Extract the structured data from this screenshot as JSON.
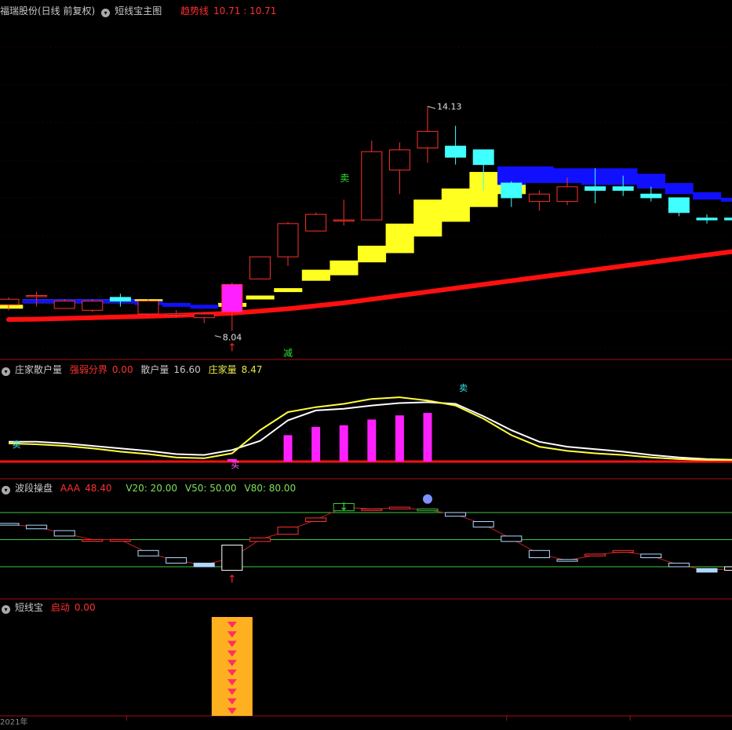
{
  "panels": {
    "main": {
      "stock": "福瑞股份(日线 前复权)",
      "indicator": "短线宝主图",
      "trend_label": "趋势线",
      "trend_value": "10.71 : 10.71",
      "high_label": "14.13",
      "low_label": "8.04",
      "sell_mark": "卖",
      "reduce_mark": "减"
    },
    "zhuangjia": {
      "title": "庄家散户量",
      "f1_label": "强弱分界",
      "f1_value": "0.00",
      "f2_label": "散户量",
      "f2_value": "16.60",
      "f3_label": "庄家量",
      "f3_value": "8.47",
      "sell_left": "卖",
      "sell_right": "卖",
      "buy_mark": "买"
    },
    "boduan": {
      "title": "波段操盘",
      "aaa_label": "AAA",
      "aaa_value": "48.40",
      "v20": "V20: 20.00",
      "v50": "V50: 50.00",
      "v80": "V80: 80.00"
    },
    "duanxianbao": {
      "title": "短线宝",
      "start_label": "启动",
      "start_value": "0.00"
    }
  },
  "footer": {
    "year_label": "2021年"
  },
  "colors": {
    "up": "#ff3030",
    "down": "#40ffff",
    "trend": "#ff1010",
    "yellow_band": "#ffff20",
    "blue_band": "#1010ff",
    "magenta": "#ff20ff",
    "white_line": "#ffffff",
    "yellow_line": "#ffff40",
    "grid_green": "#3cc83c",
    "divider": "#a01010",
    "dotted": "#4a0000"
  },
  "chart_data": [
    {
      "type": "candlestick",
      "ylim": [
        7.4,
        14.6
      ],
      "x": [
        0,
        1,
        2,
        3,
        4,
        5,
        6,
        7,
        8,
        9,
        10,
        11,
        12,
        13,
        14,
        15,
        16,
        17,
        18,
        19,
        20,
        21,
        22,
        23,
        24,
        25,
        26
      ],
      "candles": [
        [
          8.75,
          8.9,
          8.6,
          8.95
        ],
        [
          9.0,
          9.0,
          8.7,
          9.1
        ],
        [
          8.65,
          8.85,
          8.65,
          8.9
        ],
        [
          8.6,
          8.85,
          8.55,
          8.9
        ],
        [
          8.95,
          8.85,
          8.7,
          9.05
        ],
        [
          8.5,
          8.85,
          8.45,
          8.9
        ],
        [
          8.5,
          8.5,
          8.4,
          8.6
        ],
        [
          8.4,
          8.5,
          8.25,
          8.55
        ],
        [
          8.55,
          9.3,
          8.04,
          9.35
        ],
        [
          9.45,
          10.05,
          9.45,
          10.05
        ],
        [
          10.05,
          10.95,
          9.8,
          11.0
        ],
        [
          10.75,
          11.2,
          10.75,
          11.25
        ],
        [
          11.05,
          11.05,
          10.9,
          11.6
        ],
        [
          11.05,
          12.9,
          11.05,
          13.2
        ],
        [
          12.4,
          12.95,
          11.75,
          13.15
        ],
        [
          13.0,
          13.45,
          12.6,
          14.13
        ],
        [
          13.05,
          12.75,
          12.55,
          13.6
        ],
        [
          12.95,
          12.55,
          11.85,
          12.95
        ],
        [
          12.05,
          11.65,
          11.4,
          12.1
        ],
        [
          11.55,
          11.75,
          11.3,
          11.85
        ],
        [
          11.55,
          11.95,
          11.45,
          12.2
        ],
        [
          11.95,
          11.85,
          11.5,
          12.45
        ],
        [
          11.95,
          11.85,
          11.7,
          12.25
        ],
        [
          11.75,
          11.65,
          11.55,
          11.95
        ],
        [
          11.65,
          11.25,
          11.15,
          11.65
        ],
        [
          11.1,
          11.05,
          10.95,
          11.2
        ],
        [
          11.1,
          11.05,
          11.0,
          11.2
        ]
      ],
      "trend_line": [
        8.35,
        8.36,
        8.38,
        8.4,
        8.42,
        8.44,
        8.46,
        8.49,
        8.52,
        8.58,
        8.64,
        8.72,
        8.8,
        8.9,
        9.0,
        9.1,
        9.2,
        9.3,
        9.4,
        9.5,
        9.6,
        9.7,
        9.8,
        9.9,
        10.0,
        10.1,
        10.2
      ],
      "yellow_band": [
        [
          8.75,
          8.75
        ],
        [
          8.8,
          8.9
        ],
        [
          8.8,
          8.9
        ],
        [
          8.8,
          8.9
        ],
        [
          8.8,
          8.9
        ],
        [
          8.85,
          8.9
        ],
        null,
        null,
        [
          8.8,
          8.8
        ],
        [
          9.0,
          9.0
        ],
        [
          9.15,
          9.2
        ],
        [
          9.4,
          9.7
        ],
        [
          9.55,
          9.95
        ],
        [
          9.9,
          10.35
        ],
        [
          10.15,
          10.95
        ],
        [
          10.6,
          11.6
        ],
        [
          11.0,
          11.9
        ],
        [
          11.4,
          12.35
        ],
        [
          11.75,
          12.45
        ],
        null,
        null,
        null,
        null,
        null,
        null,
        null,
        null
      ],
      "blue_band": [
        null,
        [
          8.8,
          8.9
        ],
        [
          8.8,
          8.9
        ],
        [
          8.8,
          8.9
        ],
        [
          8.8,
          8.9
        ],
        [
          8.75,
          8.85
        ],
        [
          8.75,
          8.8
        ],
        [
          8.7,
          8.75
        ],
        null,
        null,
        null,
        null,
        null,
        null,
        null,
        null,
        null,
        null,
        [
          12.0,
          12.5
        ],
        [
          12.05,
          12.5
        ],
        [
          12.05,
          12.45
        ],
        [
          12.0,
          12.45
        ],
        [
          12.0,
          12.45
        ],
        [
          11.9,
          12.3
        ],
        [
          11.75,
          12.05
        ],
        [
          11.6,
          11.8
        ],
        [
          11.55,
          11.65
        ]
      ]
    },
    {
      "type": "line+bar",
      "ylim": [
        0,
        100
      ],
      "series": [
        {
          "name": "散户量",
          "values": [
            24,
            24,
            22,
            19,
            16,
            13,
            9,
            8,
            14,
            25,
            50,
            62,
            64,
            68,
            71,
            72,
            70,
            55,
            38,
            24,
            18,
            15,
            12,
            8,
            5,
            3,
            2
          ]
        },
        {
          "name": "庄家量",
          "values": [
            22,
            21,
            19,
            16,
            12,
            9,
            5,
            4,
            10,
            38,
            60,
            66,
            70,
            76,
            78,
            74,
            68,
            52,
            32,
            18,
            13,
            10,
            8,
            5,
            3,
            2,
            2
          ]
        }
      ],
      "bars": [
        0,
        0,
        0,
        0,
        0,
        0,
        0,
        0,
        3,
        0,
        32,
        42,
        44,
        51,
        56,
        59,
        0,
        0,
        0,
        0,
        0,
        0,
        0,
        0,
        0,
        0,
        0
      ],
      "threshold": 0
    },
    {
      "type": "bar",
      "ylim": [
        0,
        100
      ],
      "v_levels": [
        20,
        50,
        80
      ],
      "values": [
        [
          68,
          66
        ],
        [
          66,
          62
        ],
        [
          60,
          54
        ],
        [
          50,
          50
        ],
        [
          50,
          50
        ],
        [
          38,
          32
        ],
        [
          30,
          24
        ],
        [
          24,
          20
        ],
        [
          16,
          44
        ],
        [
          48,
          52
        ],
        [
          56,
          64
        ],
        [
          70,
          74
        ],
        [
          82,
          90
        ],
        [
          84,
          84
        ],
        [
          84,
          86
        ],
        [
          84,
          82
        ],
        [
          80,
          76
        ],
        [
          70,
          64
        ],
        [
          54,
          48
        ],
        [
          38,
          30
        ],
        [
          28,
          26
        ],
        [
          32,
          34
        ],
        [
          36,
          38
        ],
        [
          34,
          30
        ],
        [
          24,
          20
        ],
        [
          18,
          14
        ],
        [
          16,
          20
        ]
      ]
    },
    {
      "type": "bar",
      "ylim": [
        0,
        1
      ],
      "values": [
        0,
        0,
        0,
        0,
        0,
        0,
        0,
        0,
        1,
        0,
        0,
        0,
        0,
        0,
        0,
        0,
        0,
        0,
        0,
        0,
        0,
        0,
        0,
        0,
        0,
        0,
        0
      ],
      "icon_count": 10
    }
  ]
}
